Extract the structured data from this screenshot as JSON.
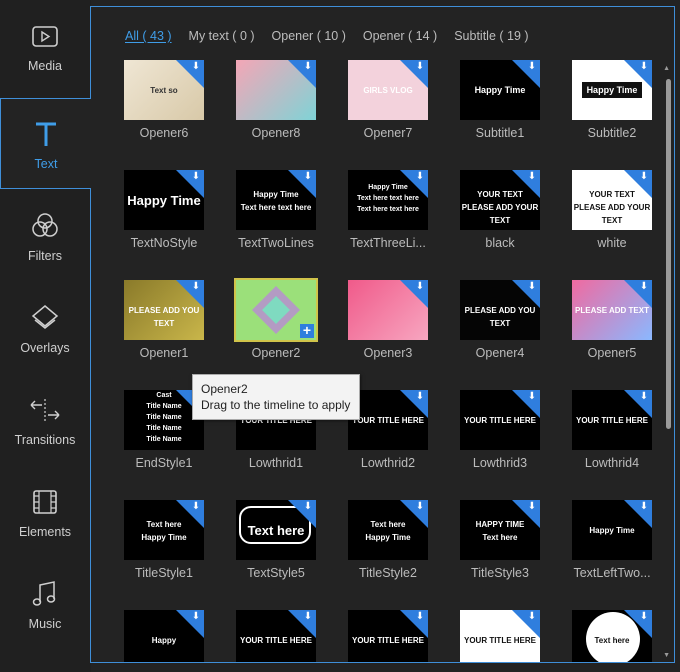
{
  "sidebar": {
    "items": [
      {
        "label": "Media",
        "icon": "media-icon",
        "active": false
      },
      {
        "label": "Text",
        "icon": "text-icon",
        "active": true
      },
      {
        "label": "Filters",
        "icon": "filters-icon",
        "active": false
      },
      {
        "label": "Overlays",
        "icon": "overlays-icon",
        "active": false
      },
      {
        "label": "Transitions",
        "icon": "transitions-icon",
        "active": false
      },
      {
        "label": "Elements",
        "icon": "elements-icon",
        "active": false
      },
      {
        "label": "Music",
        "icon": "music-icon",
        "active": false
      }
    ]
  },
  "tabs": [
    {
      "label": "All ( 43 )",
      "active": true
    },
    {
      "label": "My text ( 0 )",
      "active": false
    },
    {
      "label": "Opener ( 10 )",
      "active": false
    },
    {
      "label": "Opener ( 14 )",
      "active": false
    },
    {
      "label": "Subtitle ( 19 )",
      "active": false
    }
  ],
  "accent": "#3f8fd9",
  "tiles": [
    {
      "label": "Opener6",
      "thumb": "Text so"
    },
    {
      "label": "Opener8",
      "thumb": ""
    },
    {
      "label": "Opener7",
      "thumb": "GIRLS VLOG"
    },
    {
      "label": "Subtitle1",
      "thumb": "Happy Time"
    },
    {
      "label": "Subtitle2",
      "thumb": "Happy Time"
    },
    {
      "label": "TextNoStyle",
      "thumb": "Happy Time"
    },
    {
      "label": "TextTwoLines",
      "thumb": "Happy Time\nText here text here"
    },
    {
      "label": "TextThreeLi...",
      "thumb": "Happy Time\nText here text here\nText here text here"
    },
    {
      "label": "black",
      "thumb": "YOUR TEXT\nPLEASE ADD YOUR TEXT"
    },
    {
      "label": "white",
      "thumb": "YOUR TEXT\nPLEASE ADD YOUR TEXT"
    },
    {
      "label": "Opener1",
      "thumb": "PLEASE ADD YOU TEXT"
    },
    {
      "label": "Opener2",
      "thumb": ""
    },
    {
      "label": "Opener3",
      "thumb": ""
    },
    {
      "label": "Opener4",
      "thumb": "PLEASE ADD YOU TEXT"
    },
    {
      "label": "Opener5",
      "thumb": "PLEASE ADD TEXT"
    },
    {
      "label": "EndStyle1",
      "thumb": "Cast\nTitle Name\nTitle Name\nTitle Name\nTitle Name"
    },
    {
      "label": "Lowthrid1",
      "thumb": "YOUR TITLE HERE"
    },
    {
      "label": "Lowthrid2",
      "thumb": "YOUR TITLE HERE"
    },
    {
      "label": "Lowthrid3",
      "thumb": "YOUR TITLE HERE"
    },
    {
      "label": "Lowthrid4",
      "thumb": "YOUR TITLE HERE"
    },
    {
      "label": "TitleStyle1",
      "thumb": "Text here\nHappy Time"
    },
    {
      "label": "TextStyle5",
      "thumb": "Text here"
    },
    {
      "label": "TitleStyle2",
      "thumb": "Text here\nHappy Time"
    },
    {
      "label": "TitleStyle3",
      "thumb": "HAPPY TIME\nText here"
    },
    {
      "label": "TextLeftTwo...",
      "thumb": "Happy Time"
    },
    {
      "label": "",
      "thumb": "Happy"
    },
    {
      "label": "",
      "thumb": "YOUR TITLE HERE"
    },
    {
      "label": "",
      "thumb": "YOUR TITLE HERE"
    },
    {
      "label": "",
      "thumb": "YOUR TITLE HERE"
    },
    {
      "label": "",
      "thumb": "Text here"
    }
  ],
  "tooltip": {
    "title": "Opener2",
    "body": "Drag to the timeline to apply"
  }
}
